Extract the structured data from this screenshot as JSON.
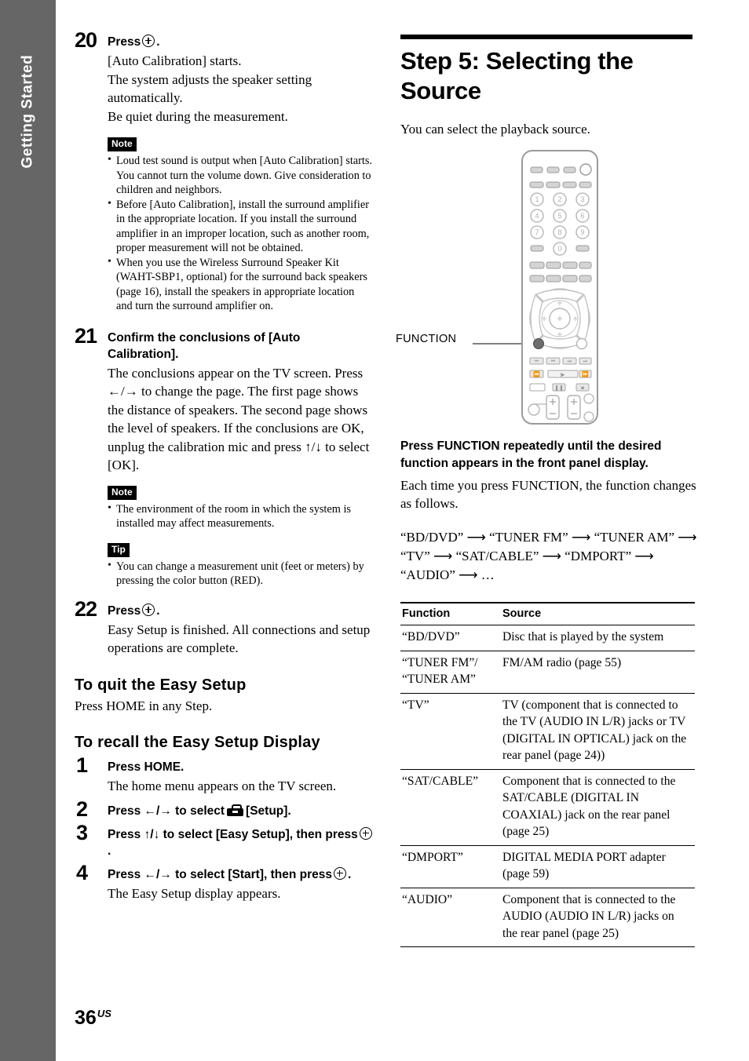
{
  "sidebar": {
    "label": "Getting Started",
    "bg_color": "#666666",
    "text_color": "#ffffff"
  },
  "page": {
    "number": "36",
    "region_suffix": "US"
  },
  "left_column": {
    "steps": [
      {
        "number": "20",
        "heading_prefix": "Press",
        "heading_suffix": ".",
        "body_lines": [
          "[Auto Calibration] starts.",
          "The system adjusts the speaker setting automatically.",
          "Be quiet during the measurement."
        ]
      },
      {
        "number": "21",
        "heading": "Confirm the conclusions of [Auto Calibration].",
        "body": "The conclusions appear on the TV screen. Press ←/→ to change the page. The first page shows the distance of speakers. The second page shows the level of speakers. If the conclusions are OK, unplug the calibration mic and press ↑/↓ to select [OK]."
      },
      {
        "number": "22",
        "heading_prefix": "Press",
        "heading_suffix": ".",
        "body": "Easy Setup is finished. All connections and setup operations are complete."
      }
    ],
    "note_block_1": {
      "badge": "Note",
      "items": [
        "Loud test sound is output when [Auto Calibration] starts. You cannot turn the volume down. Give consideration to children and neighbors.",
        "Before [Auto Calibration], install the surround amplifier in the appropriate location. If you install the surround amplifier in an improper location, such as another room, proper measurement will not be obtained.",
        "When you use the Wireless Surround Speaker Kit (WAHT-SBP1, optional) for the surround back speakers (page 16), install the speakers in appropriate location and turn the surround amplifier on."
      ]
    },
    "note_block_2": {
      "badge": "Note",
      "items": [
        "The environment of the room in which the system is installed may affect measurements."
      ]
    },
    "tip_block": {
      "badge": "Tip",
      "items": [
        "You can change a measurement unit (feet or meters) by pressing the color button (RED)."
      ]
    },
    "quit_section": {
      "heading": "To quit the Easy Setup",
      "body": "Press HOME in any Step."
    },
    "recall_section": {
      "heading": "To recall the Easy Setup Display",
      "steps": [
        {
          "number": "1",
          "heading": "Press HOME.",
          "body": "The home menu appears on the TV screen."
        },
        {
          "number": "2",
          "heading_prefix": "Press ←/→ to select",
          "heading_suffix": "[Setup]."
        },
        {
          "number": "3",
          "heading_prefix": "Press ↑/↓ to select [Easy Setup], then press",
          "heading_suffix": "."
        },
        {
          "number": "4",
          "heading_prefix": "Press ←/→ to select [Start], then press",
          "heading_suffix": ".",
          "body": "The Easy Setup display appears."
        }
      ]
    }
  },
  "right_column": {
    "title": "Step 5: Selecting the Source",
    "intro": "You can select the playback source.",
    "figure": {
      "callout_label": "FUNCTION"
    },
    "bold_lead": "Press FUNCTION repeatedly until the desired function appears in the front panel display.",
    "paragraph": "Each time you press FUNCTION, the function changes as follows.",
    "flow": "“BD/DVD” ⟶ “TUNER FM” ⟶ “TUNER AM” ⟶ “TV” ⟶ “SAT/CABLE” ⟶ “DMPORT” ⟶ “AUDIO” ⟶ …",
    "table": {
      "headers": [
        "Function",
        "Source"
      ],
      "rows": [
        {
          "function": "“BD/DVD”",
          "source": "Disc that is played by the system"
        },
        {
          "function": "“TUNER FM”/ “TUNER AM”",
          "source": "FM/AM radio (page 55)"
        },
        {
          "function": "“TV”",
          "source": "TV (component that is connected to the TV (AUDIO IN L/R) jacks or TV (DIGITAL IN OPTICAL) jack on the rear panel (page 24))"
        },
        {
          "function": "“SAT/CABLE”",
          "source": "Component that is connected to the SAT/CABLE (DIGITAL IN COAXIAL) jack on the rear panel (page 25)"
        },
        {
          "function": "“DMPORT”",
          "source": "DIGITAL MEDIA PORT adapter (page 59)"
        },
        {
          "function": "“AUDIO”",
          "source": "Component that is connected to the AUDIO (AUDIO IN L/R) jacks on the rear panel (page 25)"
        }
      ]
    }
  }
}
